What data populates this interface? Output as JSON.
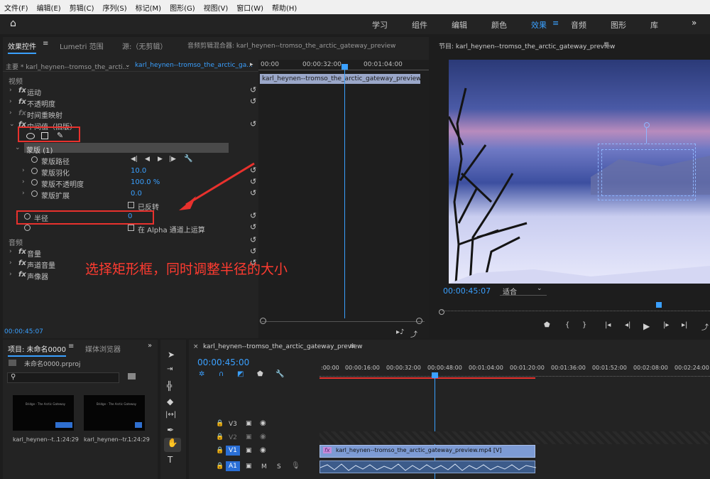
{
  "menu": [
    "文件(F)",
    "编辑(E)",
    "剪辑(C)",
    "序列(S)",
    "标记(M)",
    "图形(G)",
    "视图(V)",
    "窗口(W)",
    "帮助(H)"
  ],
  "workspaces": [
    "学习",
    "组件",
    "编辑",
    "颜色",
    "效果",
    "音频",
    "图形",
    "库"
  ],
  "workspace_active": "效果",
  "effect_panel": {
    "tabs": [
      "效果控件",
      "Lumetri 范围",
      "源:（无剪辑）",
      "音频剪辑混合器: karl_heynen--tromso_the_arctic_gateway_preview"
    ],
    "master": "主要 * karl_heynen--tromso_the_arcti...",
    "clip": "karl_heynen--tromso_the_arctic_ga...",
    "mini_ruler": [
      "00:00",
      "00:00:32:00",
      "00:01:04:00"
    ],
    "mini_clip": "karl_heynen--tromso_the_arctic_gateway_preview.mp4",
    "section_video": "视频",
    "motion": "运动",
    "opacity": "不透明度",
    "timeremap": "时间重映射",
    "median": "中间值（旧版）",
    "mask": "蒙版 (1)",
    "mask_path": "蒙版路径",
    "mask_feather": "蒙版羽化",
    "mask_feather_val": "10.0",
    "mask_opacity": "蒙版不透明度",
    "mask_opacity_val": "100.0 %",
    "mask_expand": "蒙版扩展",
    "mask_expand_val": "0.0",
    "inverted": "已反转",
    "radius": "半径",
    "radius_val": "0",
    "alpha": "在 Alpha 通道上运算",
    "section_audio": "音频",
    "volume": "音量",
    "channel_volume": "声道音量",
    "panner": "声像器",
    "timecode": "00:00:45:07"
  },
  "annotation": "选择矩形框，同时调整半径的大小",
  "program": {
    "title": "节目: karl_heynen--tromso_the_arctic_gateway_preview",
    "timecode": "00:00:45:07",
    "fit": "适合"
  },
  "project": {
    "tab": "项目: 未命名0000",
    "tab2": "媒体浏览器",
    "file": "未命名0000.prproj",
    "items": [
      {
        "name": "karl_heynen--t...",
        "dur": "1:24:29"
      },
      {
        "name": "karl_heynen--tr...",
        "dur": "1:24:29"
      }
    ],
    "thumb_text": "Bridge - The Arctic Gateway"
  },
  "timeline": {
    "title": "karl_heynen--tromso_the_arctic_gateway_preview",
    "timecode": "00:00:45:00",
    "ruler": [
      ":00:00",
      "00:00:16:00",
      "00:00:32:00",
      "00:00:48:00",
      "00:01:04:00",
      "00:01:20:00",
      "00:01:36:00",
      "00:01:52:00",
      "00:02:08:00",
      "00:02:24:00"
    ],
    "tracks": [
      "V3",
      "V2",
      "V1",
      "A1"
    ],
    "track_m": "M",
    "track_s": "S",
    "clip_v": "karl_heynen--tromso_the_arctic_gateway_preview.mp4 [V]"
  },
  "colors": {
    "accent": "#3aa0ff",
    "highlight": "#e8312d"
  }
}
